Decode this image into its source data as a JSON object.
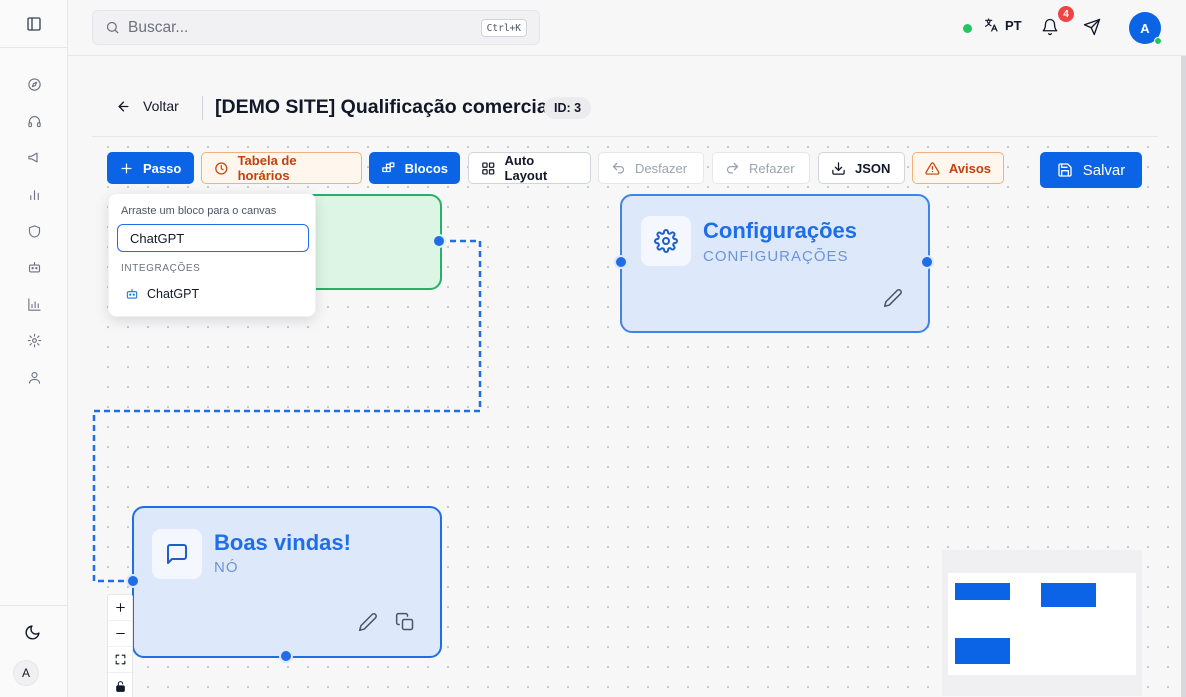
{
  "sidebar": {
    "toggle_icon": "sidebar-panel-icon",
    "items": [
      {
        "name": "compass",
        "icon": "compass-icon"
      },
      {
        "name": "headset",
        "icon": "headset-icon"
      },
      {
        "name": "megaphone",
        "icon": "megaphone-icon"
      },
      {
        "name": "bar-chart",
        "icon": "bar-chart-icon"
      },
      {
        "name": "shield",
        "icon": "shield-icon"
      },
      {
        "name": "bot",
        "icon": "bot-icon"
      },
      {
        "name": "analytics",
        "icon": "analytics-icon"
      },
      {
        "name": "settings",
        "icon": "gear-icon"
      },
      {
        "name": "user",
        "icon": "user-icon"
      }
    ],
    "theme_icon": "moon-icon",
    "avatar_initial": "A"
  },
  "topbar": {
    "search_placeholder": "Buscar...",
    "search_shortcut": "Ctrl+K",
    "language": "PT",
    "notifications_count": "4",
    "user_initial": "A",
    "status": "online"
  },
  "header": {
    "back_label": "Voltar",
    "title": "[DEMO SITE] Qualificação comercial",
    "id_badge": "ID: 3"
  },
  "toolbar": {
    "step_label": "Passo",
    "schedule_label": "Tabela de horários",
    "blocks_label": "Blocos",
    "auto_layout_label": "Auto Layout",
    "undo_label": "Desfazer",
    "redo_label": "Refazer",
    "json_label": "JSON",
    "warnings_label": "Avisos",
    "save_label": "Salvar"
  },
  "block_picker": {
    "hint": "Arraste um bloco para o canvas",
    "query": "ChatGPT",
    "section_label": "INTEGRAÇÕES",
    "results": [
      {
        "label": "ChatGPT",
        "icon": "bot-icon"
      }
    ]
  },
  "nodes": {
    "config": {
      "title": "Configurações",
      "subtitle": "CONFIGURAÇÕES",
      "icon": "gear-icon"
    },
    "welcome": {
      "title": "Boas vindas!",
      "subtitle": "NÓ",
      "icon": "message-square-icon"
    }
  },
  "colors": {
    "primary": "#0b63e5",
    "warning": "#c2410c",
    "start_node_border": "#27b066",
    "node_fill": "#dde8fb",
    "notification": "#ef4444",
    "online": "#22c55e"
  }
}
